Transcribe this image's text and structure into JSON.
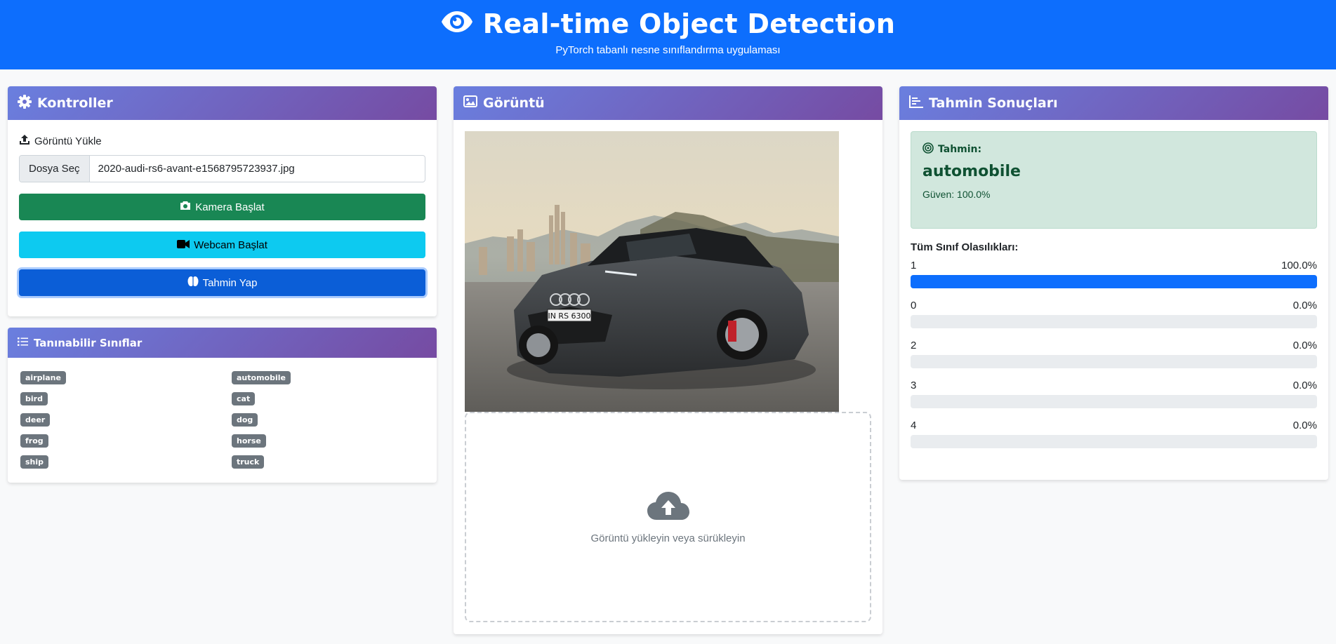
{
  "header": {
    "title": "Real-time Object Detection",
    "subtitle": "PyTorch tabanlı nesne sınıflandırma uygulaması"
  },
  "controls": {
    "title": "Kontroller",
    "upload_label": "Görüntü Yükle",
    "file_button": "Dosya Seç",
    "file_name": "2020-audi-rs6-avant-e1568795723937.jpg",
    "camera_button": "Kamera Başlat",
    "webcam_button": "Webcam Başlat",
    "predict_button": "Tahmin Yap"
  },
  "classes": {
    "title": "Tanınabilir Sınıflar",
    "items": [
      "airplane",
      "automobile",
      "bird",
      "cat",
      "deer",
      "dog",
      "frog",
      "horse",
      "ship",
      "truck"
    ]
  },
  "image_panel": {
    "title": "Görüntü",
    "dropzone_text": "Görüntü yükleyin veya sürükleyin"
  },
  "results": {
    "title": "Tahmin Sonuçları",
    "prediction_label": "Tahmin:",
    "prediction_value": "automobile",
    "confidence": "Güven: 100.0%",
    "all_probs_title": "Tüm Sınıf Olasılıkları:",
    "probs": [
      {
        "label": "1",
        "value": "100.0%",
        "fraction": 1.0
      },
      {
        "label": "0",
        "value": "0.0%",
        "fraction": 0.0
      },
      {
        "label": "2",
        "value": "0.0%",
        "fraction": 0.0
      },
      {
        "label": "3",
        "value": "0.0%",
        "fraction": 0.0
      },
      {
        "label": "4",
        "value": "0.0%",
        "fraction": 0.0
      }
    ]
  },
  "colors": {
    "primary": "#0d6efd",
    "success": "#198754",
    "info": "#0dcaf0",
    "badge": "#6c757d"
  }
}
